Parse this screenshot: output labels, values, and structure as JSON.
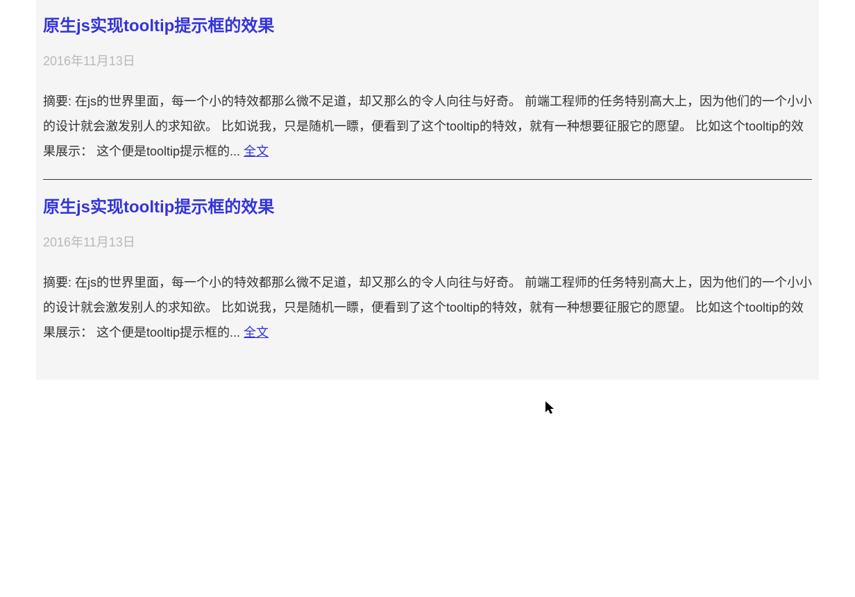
{
  "articles": [
    {
      "title": "原生js实现tooltip提示框的效果",
      "date": "2016年11月13日",
      "summary": "摘要: 在js的世界里面，每一个小的特效都那么微不足道，却又那么的令人向往与好奇。 前端工程师的任务特别高大上，因为他们的一个小小的设计就会激发别人的求知欲。 比如说我，只是随机一瞟，便看到了这个tooltip的特效，就有一种想要征服它的愿望。 比如这个tooltip的效果展示： 这个便是tooltip提示框的... ",
      "read_more": "全文"
    },
    {
      "title": "原生js实现tooltip提示框的效果",
      "date": "2016年11月13日",
      "summary": "摘要: 在js的世界里面，每一个小的特效都那么微不足道，却又那么的令人向往与好奇。 前端工程师的任务特别高大上，因为他们的一个小小的设计就会激发别人的求知欲。 比如说我，只是随机一瞟，便看到了这个tooltip的特效，就有一种想要征服它的愿望。 比如这个tooltip的效果展示： 这个便是tooltip提示框的... ",
      "read_more": "全文"
    }
  ]
}
